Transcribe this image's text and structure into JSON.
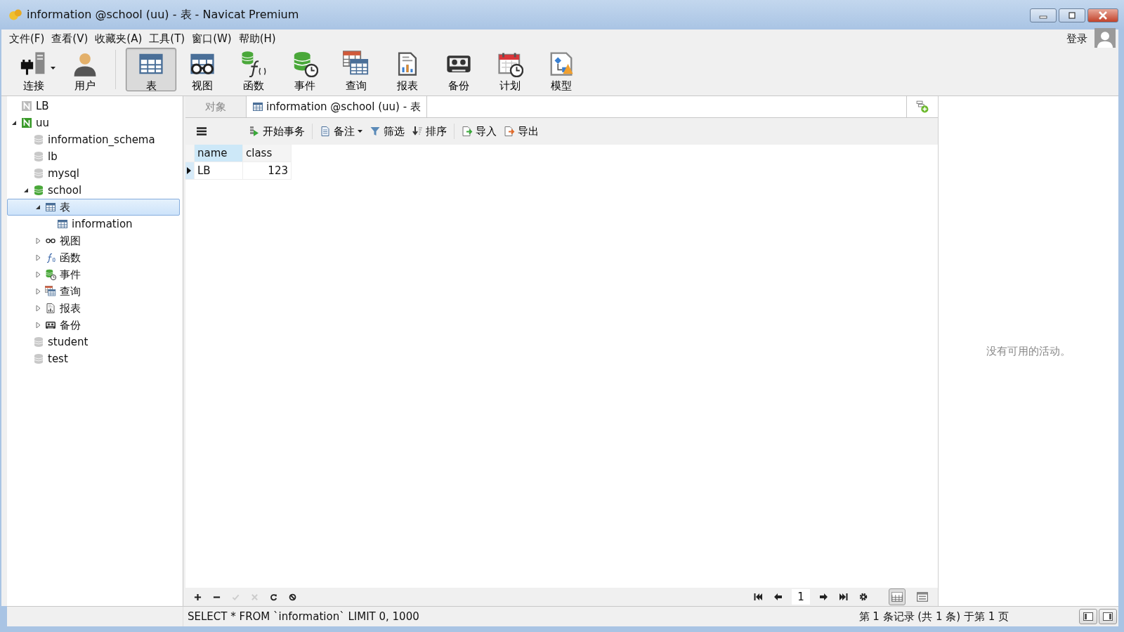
{
  "window": {
    "title": "information @school (uu) - 表 - Navicat Premium"
  },
  "menu": [
    "文件(F)",
    "查看(V)",
    "收藏夹(A)",
    "工具(T)",
    "窗口(W)",
    "帮助(H)"
  ],
  "account": {
    "label": "登录"
  },
  "toolbar": [
    {
      "label": "连接",
      "kind": "connect",
      "selected": false,
      "dropdown": true
    },
    {
      "label": "用户",
      "kind": "user",
      "selected": false,
      "dropdown": false
    },
    {
      "label": "表",
      "kind": "table",
      "selected": true,
      "dropdown": false
    },
    {
      "label": "视图",
      "kind": "view",
      "selected": false,
      "dropdown": false
    },
    {
      "label": "函数",
      "kind": "function",
      "selected": false,
      "dropdown": false
    },
    {
      "label": "事件",
      "kind": "event",
      "selected": false,
      "dropdown": false
    },
    {
      "label": "查询",
      "kind": "query",
      "selected": false,
      "dropdown": false
    },
    {
      "label": "报表",
      "kind": "report",
      "selected": false,
      "dropdown": false
    },
    {
      "label": "备份",
      "kind": "backup",
      "selected": false,
      "dropdown": false
    },
    {
      "label": "计划",
      "kind": "schedule",
      "selected": false,
      "dropdown": false
    },
    {
      "label": "模型",
      "kind": "model",
      "selected": false,
      "dropdown": false
    }
  ],
  "tree": {
    "items": [
      {
        "label": "LB",
        "kind": "connection",
        "open": false,
        "selected": false
      },
      {
        "label": "uu",
        "kind": "connection",
        "open": true,
        "expanded": true,
        "selected": false,
        "children": [
          {
            "label": "information_schema",
            "kind": "database",
            "open": false,
            "selected": false
          },
          {
            "label": "lb",
            "kind": "database",
            "open": false,
            "selected": false
          },
          {
            "label": "mysql",
            "kind": "database",
            "open": false,
            "selected": false
          },
          {
            "label": "school",
            "kind": "database",
            "open": true,
            "expanded": true,
            "selected": false,
            "children": [
              {
                "label": "表",
                "kind": "tables",
                "expanded": true,
                "selected": true,
                "children": [
                  {
                    "label": "information",
                    "kind": "table",
                    "selected": false
                  }
                ]
              },
              {
                "label": "视图",
                "kind": "views",
                "expanded": false,
                "selected": false
              },
              {
                "label": "函数",
                "kind": "functions",
                "expanded": false,
                "selected": false
              },
              {
                "label": "事件",
                "kind": "events",
                "expanded": false,
                "selected": false
              },
              {
                "label": "查询",
                "kind": "queries",
                "expanded": false,
                "selected": false
              },
              {
                "label": "报表",
                "kind": "reports",
                "expanded": false,
                "selected": false
              },
              {
                "label": "备份",
                "kind": "backups",
                "expanded": false,
                "selected": false
              }
            ]
          },
          {
            "label": "student",
            "kind": "database",
            "open": false,
            "selected": false
          },
          {
            "label": "test",
            "kind": "database",
            "open": false,
            "selected": false
          }
        ]
      }
    ]
  },
  "tabs": [
    {
      "label": "对象",
      "selected": false
    },
    {
      "label": "information @school (uu) - 表",
      "selected": true
    }
  ],
  "data_toolbar": [
    {
      "label": "开始事务",
      "kind": "transaction",
      "dropdown": false
    },
    {
      "label": "备注",
      "kind": "memo",
      "dropdown": true
    },
    {
      "label": "筛选",
      "kind": "filter",
      "dropdown": false
    },
    {
      "label": "排序",
      "kind": "sort",
      "dropdown": false
    },
    {
      "label": "导入",
      "kind": "import",
      "dropdown": false
    },
    {
      "label": "导出",
      "kind": "export",
      "dropdown": false
    }
  ],
  "grid": {
    "columns": [
      {
        "label": "name",
        "selected": true
      },
      {
        "label": "class",
        "selected": false
      }
    ],
    "rows": [
      {
        "current": true,
        "cells": [
          "LB",
          "123"
        ]
      }
    ]
  },
  "record_controls": [
    {
      "kind": "add",
      "disabled": false
    },
    {
      "kind": "delete",
      "disabled": false
    },
    {
      "kind": "apply",
      "disabled": true
    },
    {
      "kind": "discard",
      "disabled": true
    },
    {
      "kind": "refresh",
      "disabled": false
    },
    {
      "kind": "stop",
      "disabled": false
    }
  ],
  "pagination": {
    "page": "1"
  },
  "view_modes": [
    {
      "kind": "grid",
      "selected": true
    },
    {
      "kind": "form",
      "selected": false
    }
  ],
  "activity": {
    "message": "没有可用的活动。"
  },
  "status_bar": {
    "sql": "SELECT * FROM `information` LIMIT 0, 1000",
    "record": "第 1 条记录 (共 1 条) 于第 1 页"
  }
}
